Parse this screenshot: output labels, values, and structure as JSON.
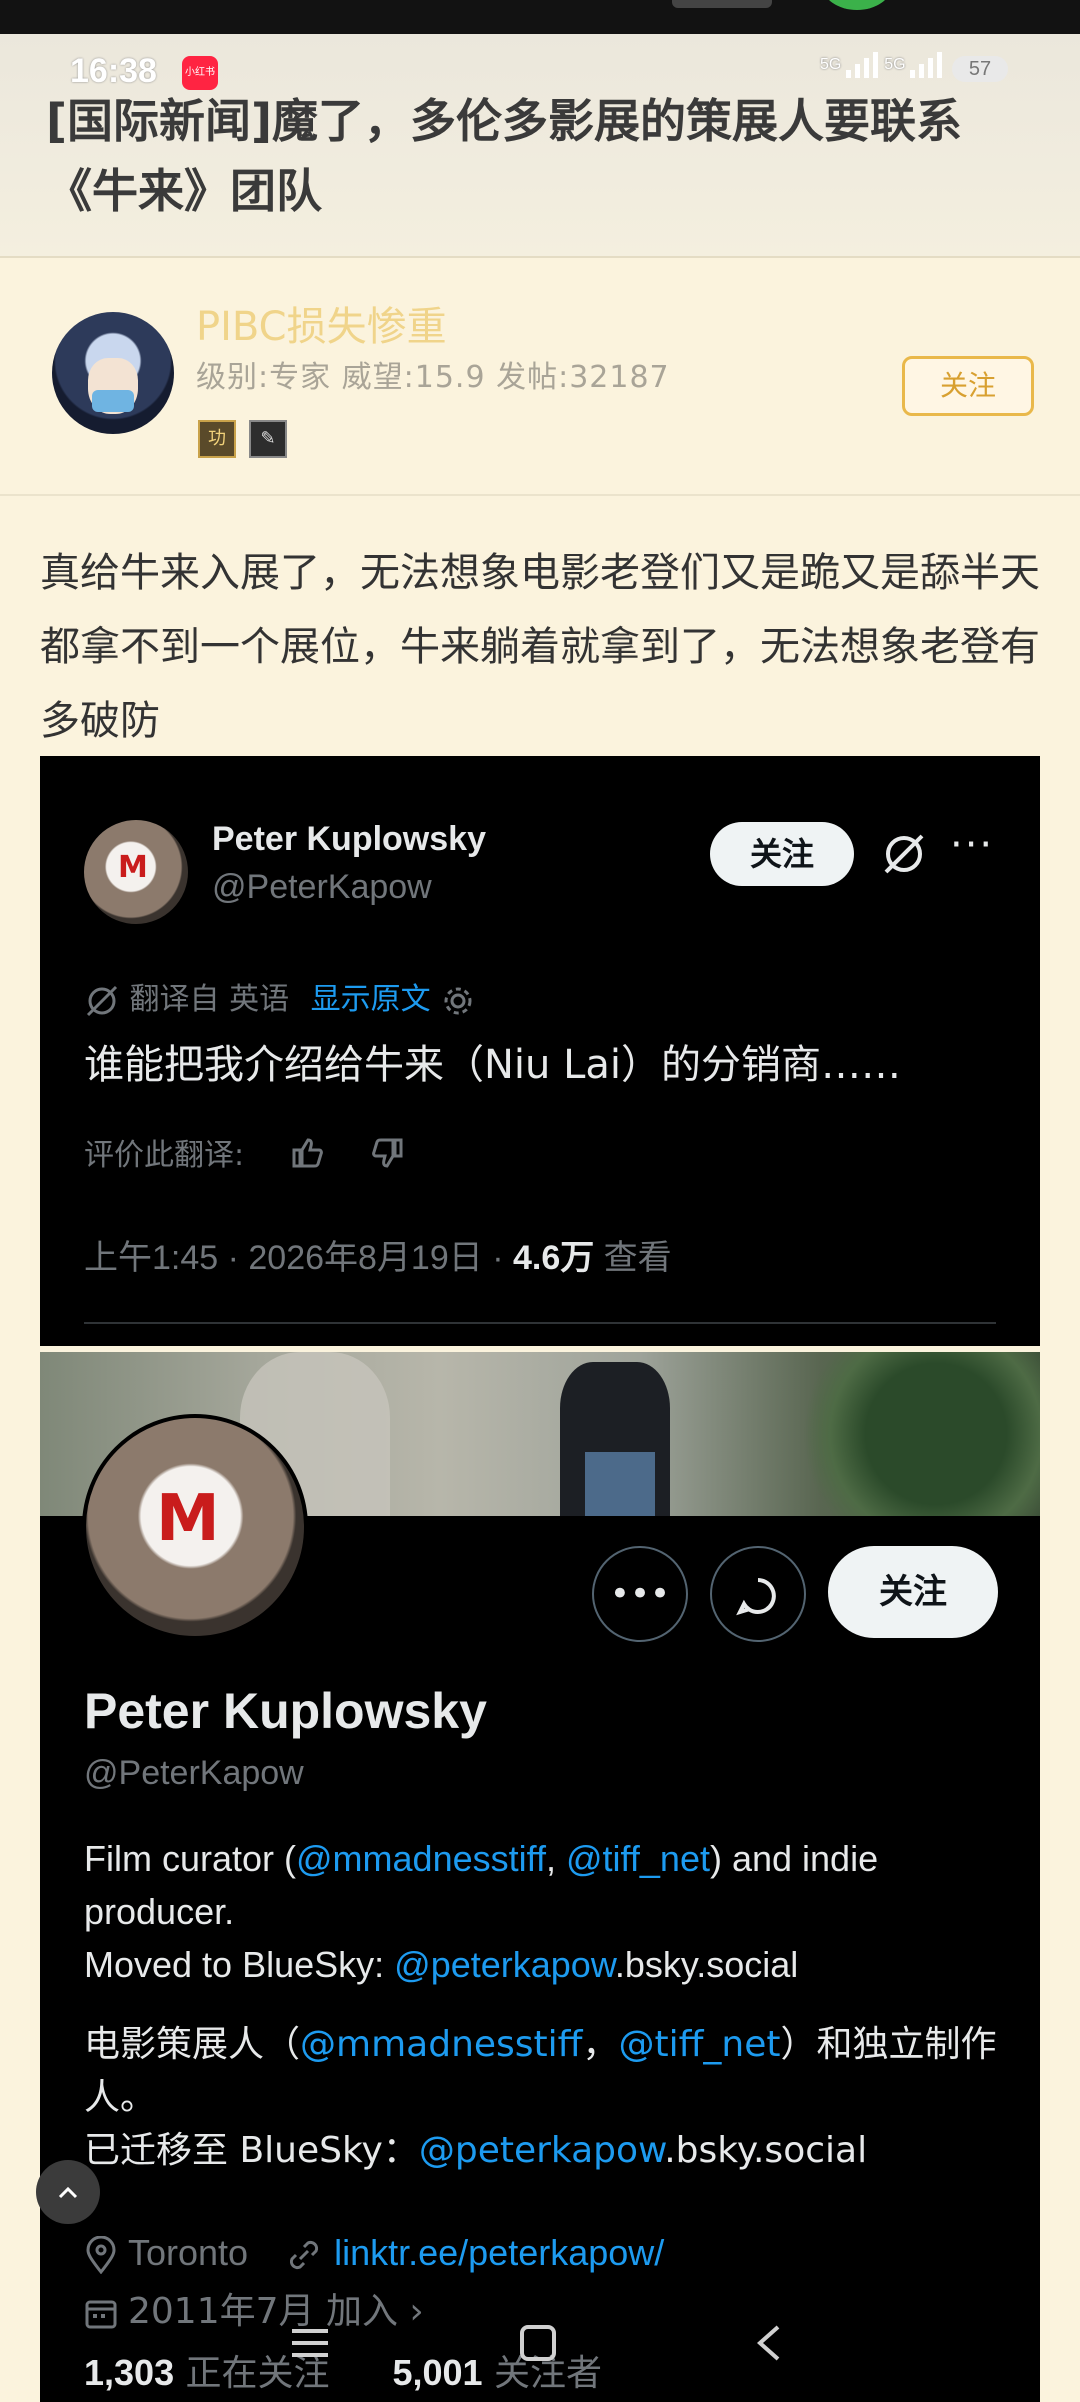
{
  "status": {
    "time": "16:38",
    "app_badge": "小红书",
    "network1": "5G",
    "network2": "5G",
    "battery": "57"
  },
  "post": {
    "title": "[国际新闻]魔了，多伦多影展的策展人要联系《牛来》团队",
    "body": "真给牛来入展了，无法想象电影老登们又是跪又是舔半天都拿不到一个展位，牛来躺着就拿到了，无法想象老登有多破防"
  },
  "author": {
    "name": "PIBC损失惨重",
    "meta": "级别:专家 威望:15.9 发帖:32187",
    "follow_label": "关注",
    "badge1": "功",
    "badge2": "✎"
  },
  "tweet": {
    "name": "Peter Kuplowsky",
    "handle": "@PeterKapow",
    "follow_label": "关注",
    "translated_from": "翻译自 英语",
    "show_original": "显示原文",
    "text": "谁能把我介绍给牛来（Niu Lai）的分销商……",
    "rate_label": "评价此翻译:",
    "time_date": "上午1:45 · 2026年8月19日 · ",
    "views": "4.6万",
    "views_label": " 查看"
  },
  "profile": {
    "name": "Peter Kuplowsky",
    "handle": "@PeterKapow",
    "follow_label": "关注",
    "bio_en_1": "Film curator (",
    "bio_en_link1": "@mmadnesstiff",
    "bio_en_sep": ", ",
    "bio_en_link2": "@tiff_net",
    "bio_en_2": ") and indie producer.",
    "bio_en_3": "Moved to BlueSky: ",
    "bio_en_link3": "@peterkapow",
    "bio_en_4": ".bsky.social",
    "bio_zh_1": "电影策展人（",
    "bio_zh_link1": "@mmadnesstiff",
    "bio_zh_sep": "，",
    "bio_zh_link2": "@tiff_net",
    "bio_zh_2": "）和独立制作人。",
    "bio_zh_3": "已迁移至 BlueSky：",
    "bio_zh_link3": "@peterkapow",
    "bio_zh_4": ".bsky.social",
    "location": "Toronto",
    "website": "linktr.ee/peterkapow/",
    "joined": "2011年7月 加入",
    "following_count": "1,303",
    "following_label": "正在关注",
    "followers_count": "5,001",
    "followers_label": "关注者"
  }
}
